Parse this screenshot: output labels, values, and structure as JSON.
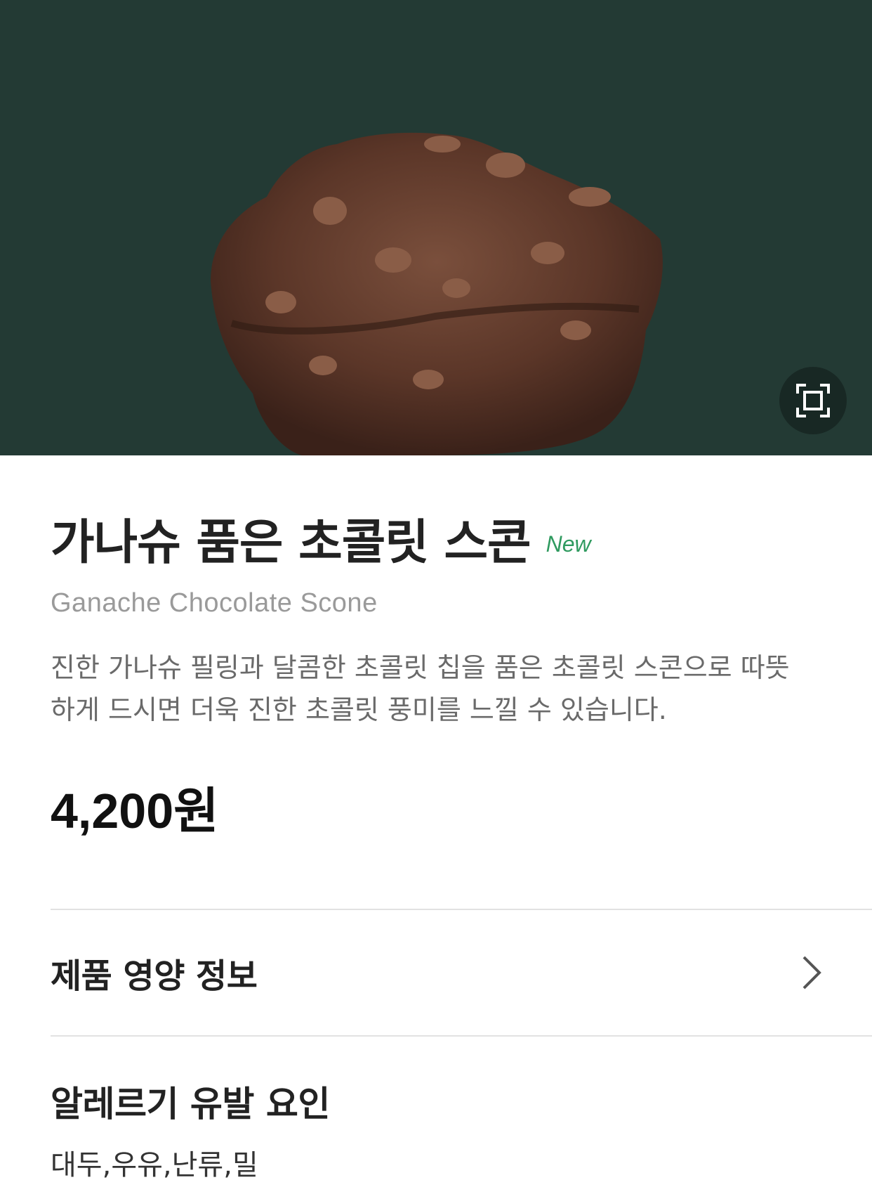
{
  "product": {
    "name_kr": "가나슈 품은 초콜릿 스콘",
    "badge": "New",
    "name_en": "Ganache Chocolate Scone",
    "description": "진한 가나슈 필링과 달콤한 초콜릿 칩을 품은 초콜릿 스콘으로 따뜻하게 드시면 더욱 진한 초콜릿 풍미를 느낄 수 있습니다.",
    "price": "4,200원"
  },
  "sections": {
    "nutrition_label": "제품 영양 정보",
    "allergy_title": "알레르기 유발 요인",
    "allergy_items": "대두,우유,난류,밀"
  },
  "colors": {
    "hero_bg": "#233a34",
    "badge_green": "#2f9a5f"
  },
  "icons": {
    "fullscreen": "fullscreen-icon",
    "chevron": "chevron-right-icon"
  }
}
